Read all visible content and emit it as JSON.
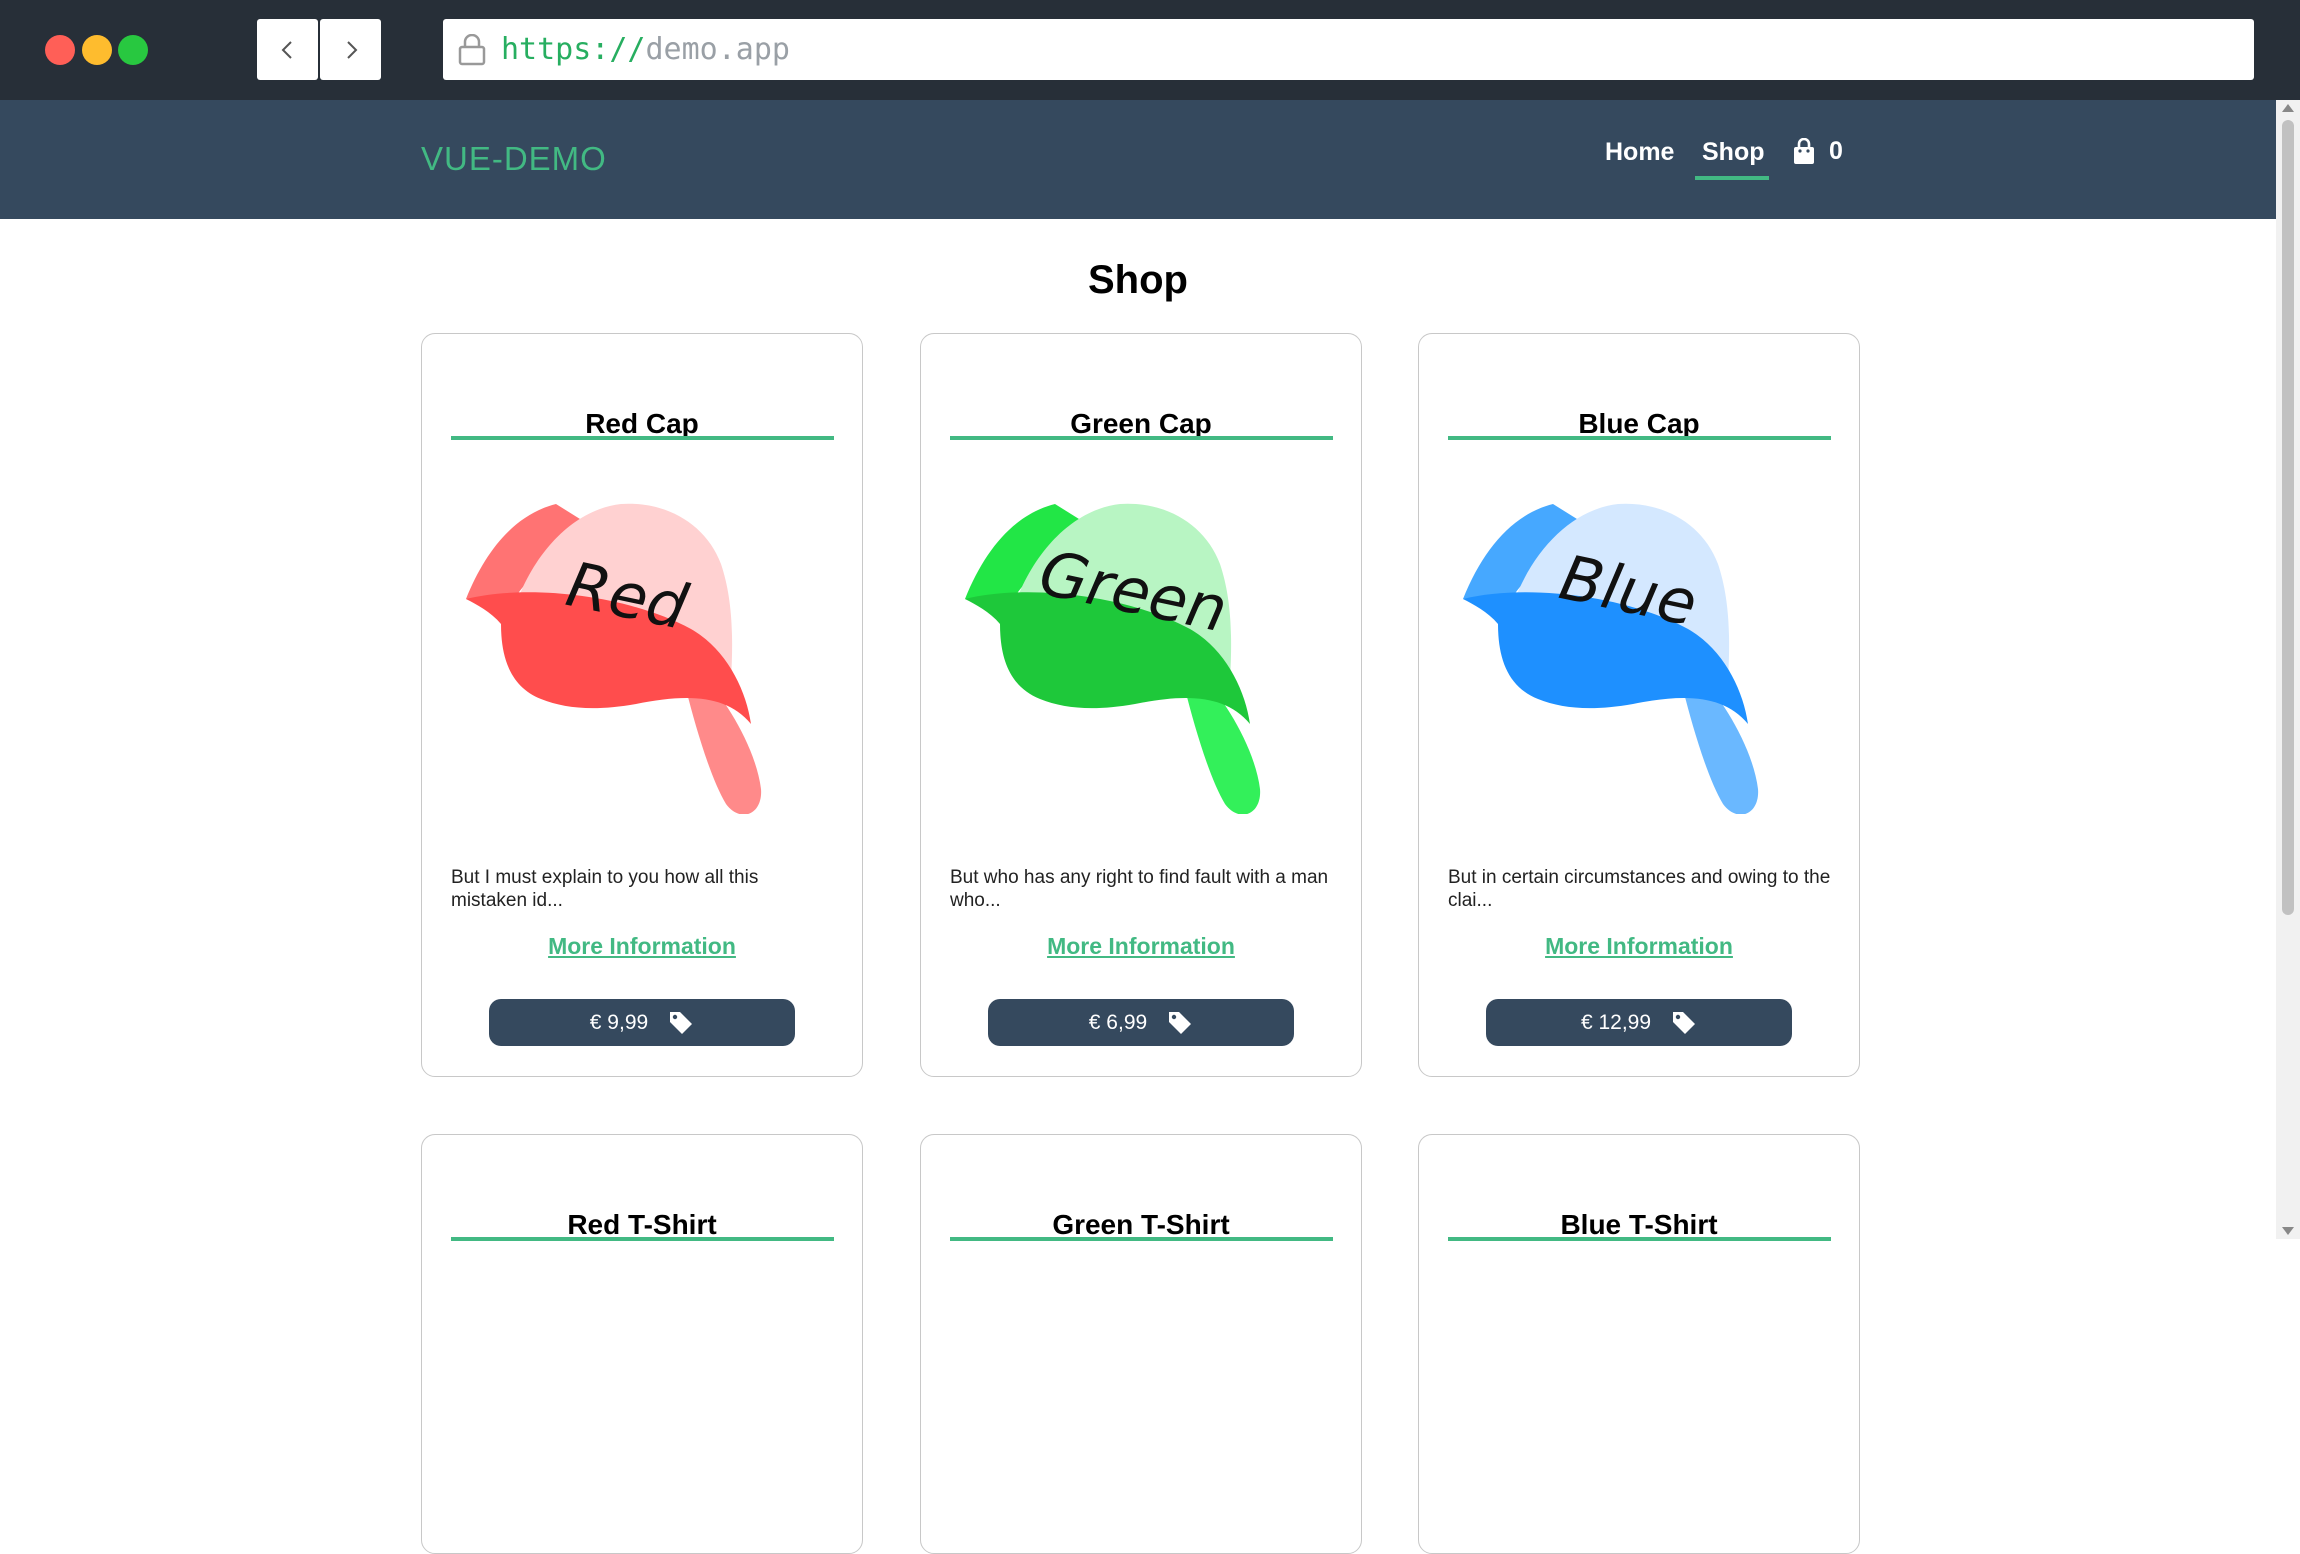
{
  "browser": {
    "url_scheme": "https://",
    "url_host": "demo.app"
  },
  "header": {
    "brand": "VUE-DEMO",
    "nav": {
      "home": "Home",
      "shop": "Shop"
    },
    "cart_count": "0"
  },
  "page": {
    "title": "Shop"
  },
  "products": [
    {
      "name": "Red Cap",
      "cap_word": "Red",
      "description": "But I must explain to you how all this mistaken id...",
      "more_label": "More Information",
      "price": "€ 9,99",
      "colors": {
        "front": "#ff4d4d",
        "crown": "#ffd1d1",
        "side": "#ff7373",
        "visor": "#ff8a8a"
      }
    },
    {
      "name": "Green Cap",
      "cap_word": "Green",
      "description": "But who has any right to find fault with a man who...",
      "more_label": "More Information",
      "price": "€ 6,99",
      "colors": {
        "front": "#1ec83a",
        "crown": "#b8f5c3",
        "side": "#22e646",
        "visor": "#33f05a"
      }
    },
    {
      "name": "Blue Cap",
      "cap_word": "Blue",
      "description": "But in certain circumstances and owing to the clai...",
      "more_label": "More Information",
      "price": "€ 12,99",
      "colors": {
        "front": "#1e90ff",
        "crown": "#d4e8ff",
        "side": "#46a8ff",
        "visor": "#6ab8ff"
      }
    },
    {
      "name": "Red T-Shirt"
    },
    {
      "name": "Green T-Shirt"
    },
    {
      "name": "Blue T-Shirt"
    }
  ],
  "theme": {
    "accent": "#42b983",
    "header_bg": "#35495e"
  }
}
